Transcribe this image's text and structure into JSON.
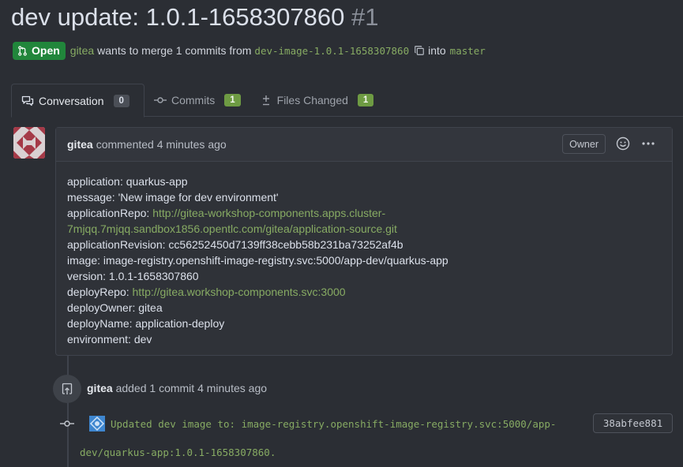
{
  "pr": {
    "title": "dev update: 1.0.1-1658307860",
    "number": "#1",
    "state_label": "Open",
    "author": "gitea",
    "merge_text": "wants to merge 1 commits from",
    "head_branch": "dev-image-1.0.1-1658307860",
    "into_text": "into",
    "base_branch": "master"
  },
  "tabs": [
    {
      "label": "Conversation",
      "count": "0",
      "icon": "comment-discussion-icon"
    },
    {
      "label": "Commits",
      "count": "1",
      "icon": "git-commit-icon"
    },
    {
      "label": "Files Changed",
      "count": "1",
      "icon": "diff-icon"
    }
  ],
  "comment": {
    "author": "gitea",
    "action": "commented",
    "time": "4 minutes ago",
    "role_badge": "Owner",
    "lines": {
      "application": "application: quarkus-app",
      "message": "message: 'New image for dev environment'",
      "app_repo_key": "applicationRepo: ",
      "app_repo_url_1": "http://gitea-workshop-components.apps.cluster-",
      "app_repo_url_2": "7mjqq.7mjqq.sandbox1856.opentlc.com/gitea/application-source.git",
      "revision": "applicationRevision: cc56252450d7139ff38cebb58b231ba73252af4b",
      "image": "image: image-registry.openshift-image-registry.svc:5000/app-dev/quarkus-app",
      "version": "version: 1.0.1-1658307860",
      "deploy_repo_key": "deployRepo: ",
      "deploy_repo_url": "http://gitea.workshop-components.svc:3000",
      "deploy_owner": "deployOwner: gitea",
      "deploy_name": "deployName: application-deploy",
      "environment": "environment: dev"
    }
  },
  "event": {
    "author": "gitea",
    "text": "added 1 commit 4 minutes ago"
  },
  "commit": {
    "message_line1": "Updated dev image to: image-registry.openshift-image-registry.svc:5000/app-",
    "message_line2": "dev/quarkus-app:1.0.1-1658307860.",
    "sha": "38abfee881"
  },
  "colors": {
    "background": "#2b2e34",
    "accent_green": "#87ab63",
    "open_state": "#21863b"
  }
}
